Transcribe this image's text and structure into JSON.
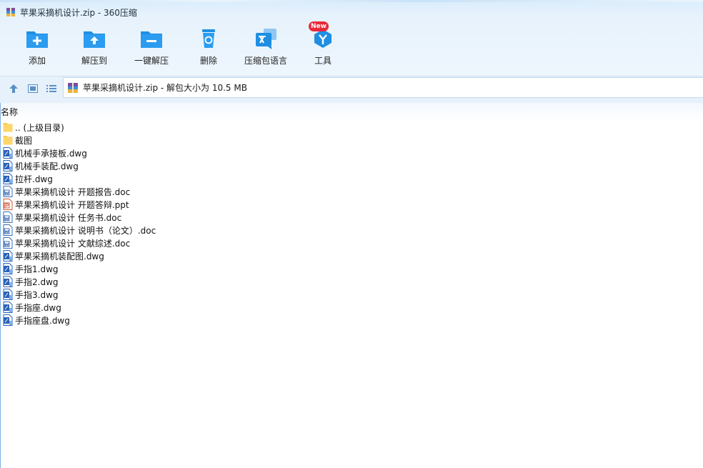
{
  "window": {
    "title": "苹果采摘机设计.zip - 360压缩",
    "app_icon": "winrar-archive-icon"
  },
  "toolbar": {
    "items": [
      {
        "label": "添加",
        "icon": "folder-add-icon"
      },
      {
        "label": "解压到",
        "icon": "folder-extract-icon"
      },
      {
        "label": "一键解压",
        "icon": "folder-quick-extract-icon"
      },
      {
        "label": "删除",
        "icon": "recycle-bin-icon"
      },
      {
        "label": "压缩包语言",
        "icon": "language-icon"
      },
      {
        "label": "工具",
        "icon": "tools-icon",
        "badge": "New"
      }
    ]
  },
  "navbar": {
    "up_icon": "arrow-up-icon",
    "view_thumbnail_icon": "thumbnail-view-icon",
    "view_list_icon": "list-view-icon",
    "address": "苹果采摘机设计.zip - 解包大小为 10.5 MB"
  },
  "columns": {
    "name": "名称"
  },
  "files": [
    {
      "name": ".. (上级目录)",
      "type": "folder"
    },
    {
      "name": "截图",
      "type": "folder"
    },
    {
      "name": "机械手承接板.dwg",
      "type": "dwg"
    },
    {
      "name": "机械手装配.dwg",
      "type": "dwg"
    },
    {
      "name": "拉杆.dwg",
      "type": "dwg"
    },
    {
      "name": "苹果采摘机设计 开题报告.doc",
      "type": "doc"
    },
    {
      "name": "苹果采摘机设计 开题答辩.ppt",
      "type": "ppt"
    },
    {
      "name": "苹果采摘机设计 任务书.doc",
      "type": "doc"
    },
    {
      "name": "苹果采摘机设计 说明书（论文）.doc",
      "type": "doc"
    },
    {
      "name": "苹果采摘机设计 文献综述.doc",
      "type": "doc"
    },
    {
      "name": "苹果采摘机装配图.dwg",
      "type": "dwg"
    },
    {
      "name": "手指1.dwg",
      "type": "dwg"
    },
    {
      "name": "手指2.dwg",
      "type": "dwg"
    },
    {
      "name": "手指3.dwg",
      "type": "dwg"
    },
    {
      "name": "手指座.dwg",
      "type": "dwg"
    },
    {
      "name": "手指座盘.dwg",
      "type": "dwg"
    }
  ],
  "colors": {
    "accent": "#1e8fe3",
    "badge": "#ea2a3a",
    "folder": "#fcd56b"
  }
}
